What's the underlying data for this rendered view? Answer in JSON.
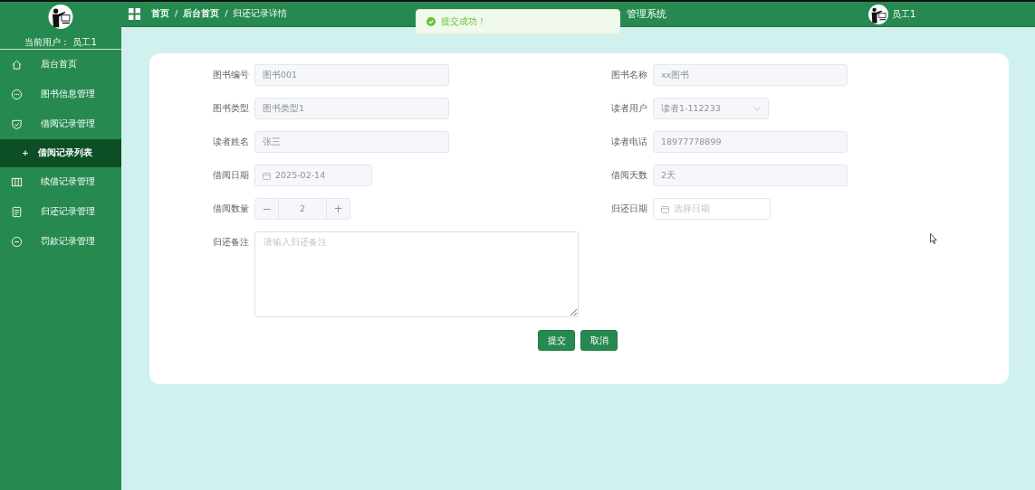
{
  "header": {
    "breadcrumb": [
      "首页",
      "后台首页",
      "归还记录详情"
    ],
    "separator": "/",
    "title": "管理系统",
    "user": "员工1"
  },
  "toast": {
    "message": "提交成功！"
  },
  "sidebar": {
    "current_user": "当前用户： 员工1",
    "items": [
      {
        "label": "后台首页"
      },
      {
        "label": "图书信息管理"
      },
      {
        "label": "借阅记录管理",
        "children": [
          {
            "label": "借阅记录列表",
            "selected": true,
            "icon_text": "+"
          }
        ]
      },
      {
        "label": "续借记录管理"
      },
      {
        "label": "归还记录管理"
      },
      {
        "label": "罚款记录管理"
      }
    ]
  },
  "form": {
    "fields": [
      {
        "label": "图书编号",
        "kind": "text",
        "value": "图书001",
        "disabled": true
      },
      {
        "label": "图书名称",
        "kind": "text",
        "value": "xx图书",
        "disabled": true
      },
      {
        "label": "图书类型",
        "kind": "text",
        "value": "图书类型1",
        "disabled": true
      },
      {
        "label": "读者用户",
        "kind": "select",
        "value": "读者1-112233",
        "disabled": true
      },
      {
        "label": "读者姓名",
        "kind": "text",
        "value": "张三",
        "disabled": true
      },
      {
        "label": "读者电话",
        "kind": "text",
        "value": "18977778899",
        "disabled": true
      },
      {
        "label": "借阅日期",
        "kind": "date",
        "value": "2025-02-14",
        "disabled": true
      },
      {
        "label": "借阅天数",
        "kind": "text",
        "value": "2天",
        "disabled": true
      },
      {
        "label": "借阅数量",
        "kind": "number",
        "value": "2",
        "minus": "−",
        "plus": "+",
        "disabled": true
      },
      {
        "label": "归还日期",
        "kind": "date",
        "placeholder": "选择日期",
        "disabled": false
      },
      {
        "label": "归还备注",
        "kind": "textarea",
        "placeholder": "请输入归还备注",
        "disabled": false
      }
    ],
    "buttons": [
      "提交",
      "取消"
    ]
  }
}
